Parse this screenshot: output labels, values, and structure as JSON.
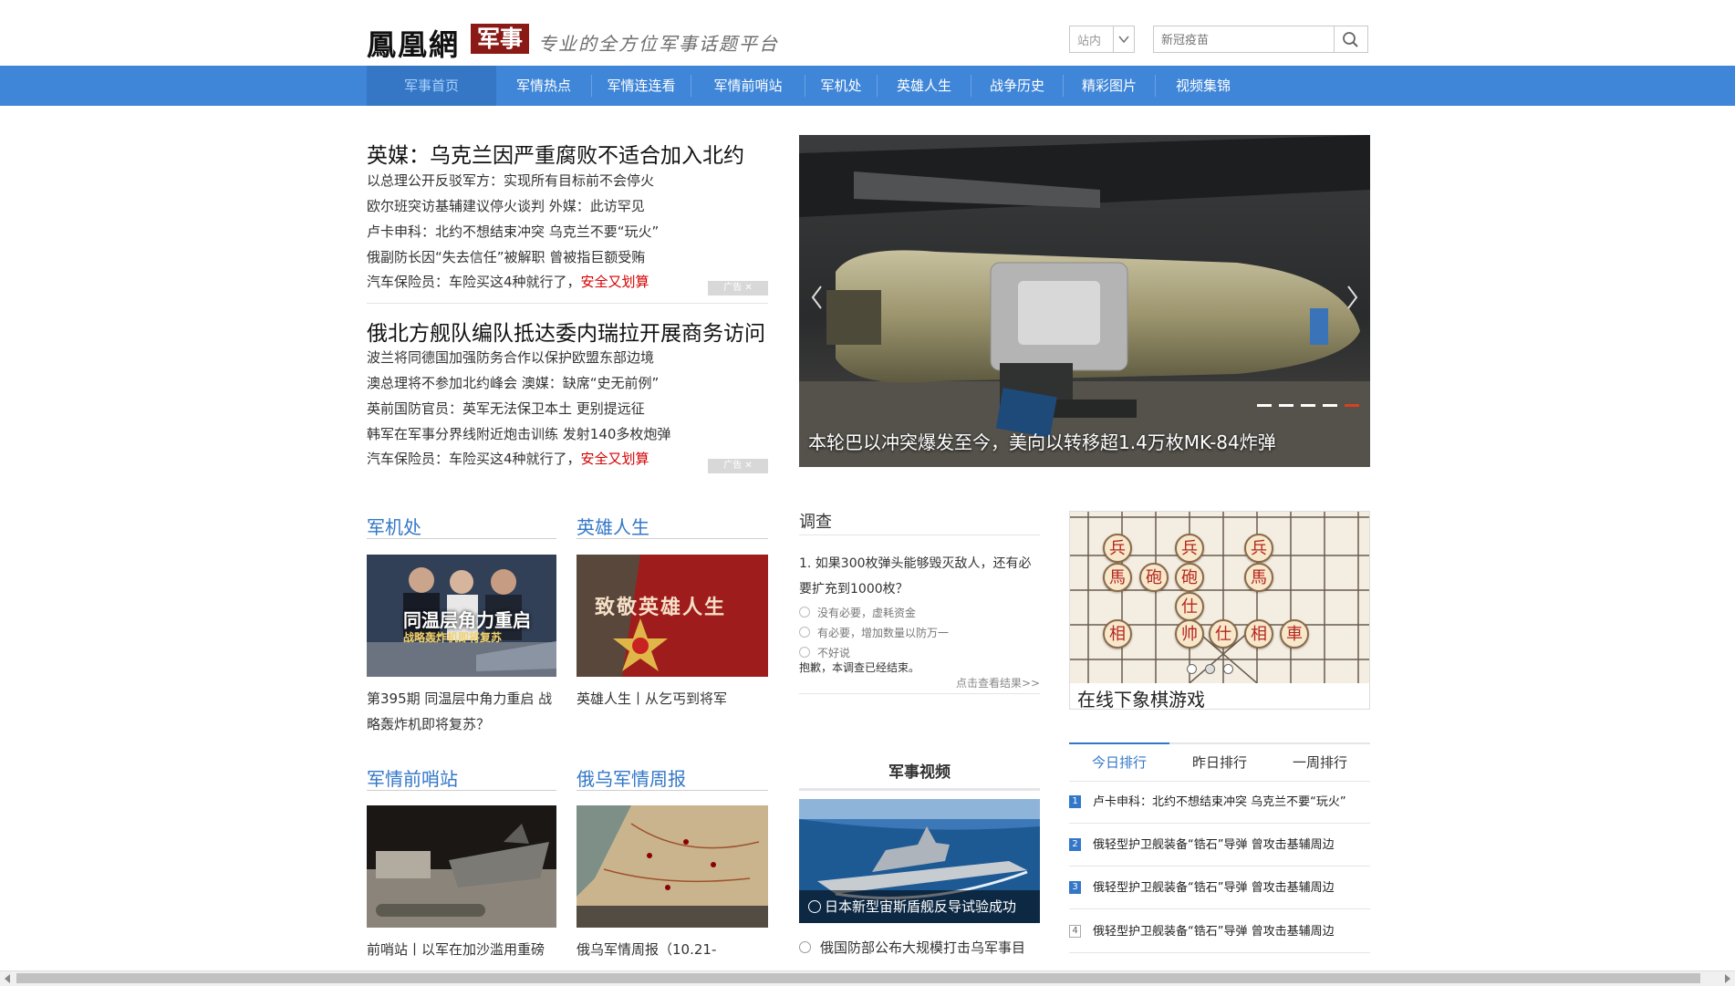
{
  "header": {
    "logo": "鳳凰網",
    "logo_section": "军事",
    "slogan": "专业的全方位军事话题平台",
    "site_select": "站内",
    "search_placeholder": "新冠疫苗"
  },
  "nav": {
    "items": [
      "军事首页",
      "军情热点",
      "军情连连看",
      "军情前哨站",
      "军机处",
      "英雄人生",
      "战争历史",
      "精彩图片",
      "视频集锦"
    ],
    "active": "军事首页"
  },
  "headlines": [
    {
      "title": "英媒：乌克兰因严重腐败不适合加入北约",
      "lines": [
        "以总理公开反驳军方：实现所有目标前不会停火",
        "欧尔班突访基辅建议停火谈判  外媒：此访罕见",
        "卢卡申科：北约不想结束冲突  乌克兰不要“玩火”",
        "俄副防长因“失去信任”被解职  曾被指巨额受贿"
      ],
      "ad_line": {
        "before": "汽车保险员：车险买这4种就行了，",
        "highlight": "安全又划算"
      },
      "ad_tag": "广告"
    },
    {
      "title": "俄北方舰队编队抵达委内瑞拉开展商务访问",
      "lines": [
        "波兰将同德国加强防务合作以保护欧盟东部边境",
        "澳总理将不参加北约峰会  澳媒：缺席“史无前例”",
        "英前国防官员：英军无法保卫本土  更别提远征",
        "韩军在军事分界线附近炮击训练  发射140多枚炮弹"
      ],
      "ad_line": {
        "before": "汽车保险员：车险买这4种就行了，",
        "highlight": "安全又划算"
      },
      "ad_tag": "广告"
    }
  ],
  "carousel": {
    "caption": "本轮巴以冲突爆发至今，美向以转移超1.4万枚MK-84炸弹",
    "slide_count": 5,
    "active_slide": 5
  },
  "sections": {
    "jun_ji_chu": {
      "title": "军机处",
      "caption": "第395期  同温层中角力重启  战略轰炸机即将复苏？",
      "thumb_text": "同温层角力重启",
      "thumb_sub": "战略轰炸机即将复苏"
    },
    "ying_xiong": {
      "title": "英雄人生",
      "caption": "英雄人生丨从乞丐到将军",
      "thumb_text": "致敬英雄人生"
    },
    "qian_shao": {
      "title": "军情前哨站",
      "caption": "前哨站丨以军在加沙滥用重磅"
    },
    "e_wu": {
      "title": "俄乌军情周报",
      "caption": "俄乌军情周报（10.21-"
    }
  },
  "poll": {
    "title": "调查",
    "question": "1.  如果300枚弹头能够毁灭敌人，还有必要扩充到1000枚？",
    "options": [
      "没有必要，虚耗资金",
      "有必要，增加数量以防万一",
      "不好说"
    ],
    "note": "抱歉，本调查已经结束。",
    "more": "点击查看结果>>"
  },
  "game": {
    "title": "在线下象棋游戏",
    "pieces": [
      "兵",
      "兵",
      "兵",
      "馬",
      "砲",
      "砲",
      "馬",
      "仕",
      "相",
      "帅",
      "仕",
      "相",
      "車"
    ]
  },
  "ranking": {
    "tabs": [
      "今日排行",
      "昨日排行",
      "一周排行"
    ],
    "active_tab": "今日排行",
    "items": [
      {
        "num": "1",
        "text": "卢卡申科：北约不想结束冲突  乌克兰不要“玩火”"
      },
      {
        "num": "2",
        "text": "俄轻型护卫舰装备“锆石”导弹  曾攻击基辅周边"
      },
      {
        "num": "3",
        "text": "俄轻型护卫舰装备“锆石”导弹  曾攻击基辅周边"
      },
      {
        "num": "4",
        "text": "俄轻型护卫舰装备“锆石”导弹  曾攻击基辅周边"
      }
    ]
  },
  "video": {
    "title": "军事视频",
    "caption": "日本新型宙斯盾舰反导试验成功",
    "link": "俄国防部公布大规模打击乌军事目"
  },
  "colors": {
    "nav_bg": "#3f86d8",
    "accent_blue": "#3377c8",
    "logo_red": "#8b1a16",
    "ad_red": "#d40000"
  }
}
